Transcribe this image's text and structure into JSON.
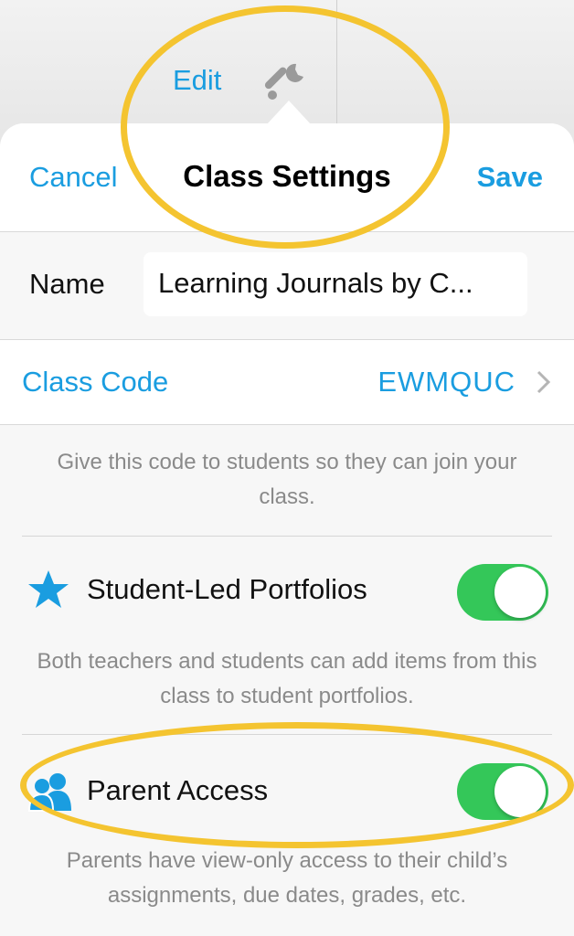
{
  "background": {
    "edit_label": "Edit"
  },
  "navbar": {
    "cancel_label": "Cancel",
    "title": "Class Settings",
    "save_label": "Save"
  },
  "settings": {
    "name_label": "Name",
    "name_value": "Learning Journals by C...",
    "class_code_label": "Class Code",
    "class_code_value": "EWMQUC",
    "class_code_note": "Give this code to students so they can join your class.",
    "portfolios_label": "Student-Led Portfolios",
    "portfolios_enabled": true,
    "portfolios_note": "Both teachers and students can add items from this class to student portfolios.",
    "parent_access_label": "Parent Access",
    "parent_access_enabled": true,
    "parent_access_note": "Parents have view-only access to their child’s assignments, due dates, grades, etc."
  },
  "colors": {
    "accent": "#1a9de0",
    "toggle_on": "#34c759",
    "highlight": "#f4c430"
  },
  "icons": [
    "wrench-icon",
    "chevron-right-icon",
    "star-icon",
    "parents-icon"
  ]
}
